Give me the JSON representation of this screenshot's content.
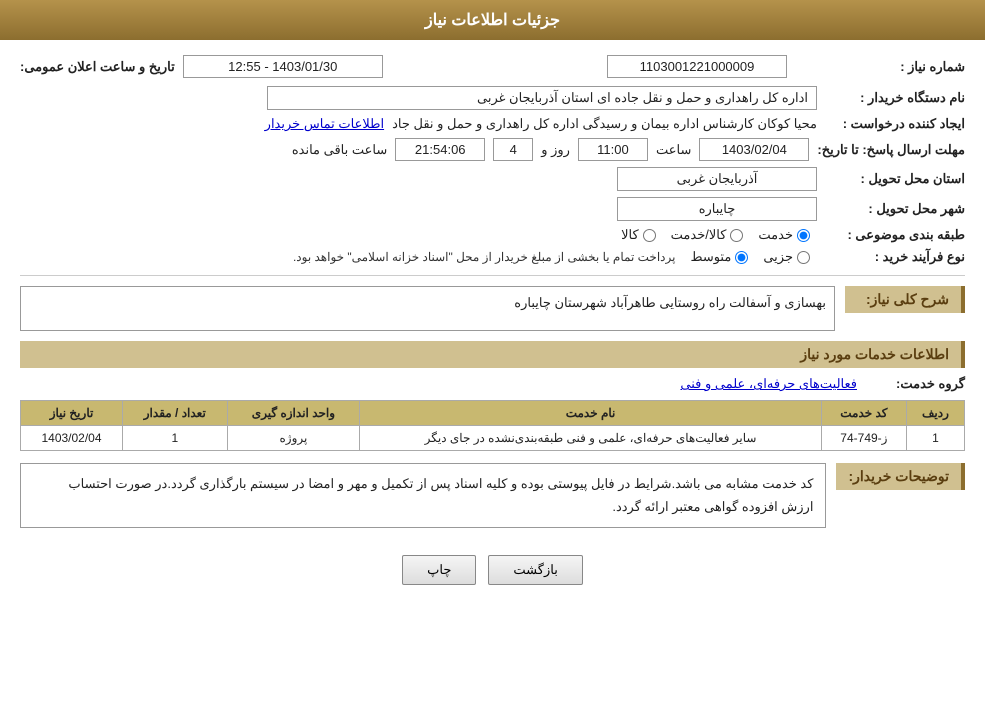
{
  "header": {
    "title": "جزئیات اطلاعات نیاز"
  },
  "fields": {
    "shomareNiaz_label": "شماره نیاز :",
    "shomareNiaz_value": "1103001221000009",
    "namDastgah_label": "نام دستگاه خریدار :",
    "namDastgah_value": "اداره کل راهداری و حمل و نقل جاده ای استان آذربایجان غربی",
    "ijadKonande_label": "ایجاد کننده درخواست :",
    "ijadKonande_value": "محیا کوکان کارشناس اداره بیمان و رسیدگی اداره کل راهداری و حمل و نقل جاد",
    "ijadKonande_link": "اطلاعات تماس خریدار",
    "mohlat_label": "مهلت ارسال پاسخ: تا تاریخ:",
    "mohlat_date": "1403/02/04",
    "mohlat_saat_label": "ساعت",
    "mohlat_saat": "11:00",
    "mohlat_roz_label": "روز و",
    "mohlat_roz": "4",
    "mohlat_remaining_label": "ساعت باقی مانده",
    "mohlat_remaining": "21:54:06",
    "ostan_label": "استان محل تحویل :",
    "ostan_value": "آذربایجان غربی",
    "shahr_label": "شهر محل تحویل :",
    "shahr_value": "چایباره",
    "tabaqe_label": "طبقه بندی موضوعی :",
    "tabaqe_options": [
      "خدمت",
      "کالا/خدمت",
      "کالا"
    ],
    "tabaqe_selected": "خدمت",
    "noeFarayand_label": "نوع فرآیند خرید :",
    "noeFarayand_options": [
      "جزیی",
      "متوسط"
    ],
    "noeFarayand_selected": "متوسط",
    "noeFarayand_desc": "پرداخت تمام یا بخشی از مبلغ خریدار از محل \"اسناد خزانه اسلامی\" خواهد بود.",
    "tarikhElan_label": "تاریخ و ساعت اعلان عمومی:",
    "tarikhElan_value": "1403/01/30 - 12:55",
    "sharhNiaz_section": "شرح کلی نیاز:",
    "sharhNiaz_value": "بهسازی و آسفالت راه روستایی طاهرآباد شهرستان چایباره",
    "khadamat_section": "اطلاعات خدمات مورد نیاز",
    "grouhKhadamat_label": "گروه خدمت:",
    "grouhKhadamat_value": "فعالیت‌های حرفه‌ای، علمی و فنی",
    "table": {
      "headers": [
        "ردیف",
        "کد خدمت",
        "نام خدمت",
        "واحد اندازه گیری",
        "تعداد / مقدار",
        "تاریخ نیاز"
      ],
      "rows": [
        {
          "radif": "1",
          "kodKhadamat": "ز-749-74",
          "namKhadamat": "سایر فعالیت‌های حرفه‌ای، علمی و فنی طبقه‌بندی‌نشده در جای دیگر",
          "vahed": "پروژه",
          "tedad": "1",
          "tarikh": "1403/02/04"
        }
      ]
    },
    "tozihat_label": "توضیحات خریدار:",
    "tozihat_value": "کد خدمت مشابه می باشد.شرایط در فایل پیوستی بوده و کلیه اسناد پس از تکمیل و مهر و امضا در سیستم بارگذاری گردد.در صورت احتساب ارزش افزوده گواهی معتبر ارائه گردد."
  },
  "buttons": {
    "print_label": "چاپ",
    "back_label": "بازگشت"
  }
}
